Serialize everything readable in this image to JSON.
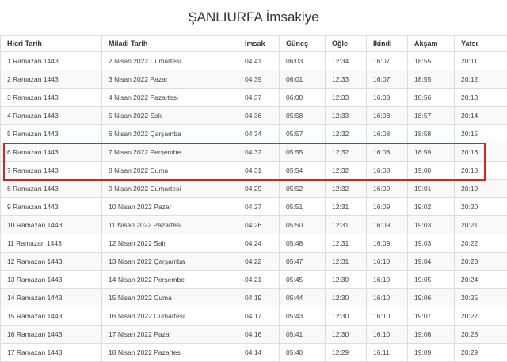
{
  "title": "ŞANLIURFA İmsakiye",
  "columns": [
    "Hicri Tarih",
    "Miladi Tarih",
    "İmsak",
    "Güneş",
    "Öğle",
    "İkindi",
    "Akşam",
    "Yatsı"
  ],
  "rows": [
    [
      "1 Ramazan 1443",
      "2 Nisan 2022 Cumartesi",
      "04:41",
      "06:03",
      "12:34",
      "16:07",
      "18:55",
      "20:11"
    ],
    [
      "2 Ramazan 1443",
      "3 Nisan 2022 Pazar",
      "04:39",
      "06:01",
      "12:33",
      "16:07",
      "18:55",
      "20:12"
    ],
    [
      "3 Ramazan 1443",
      "4 Nisan 2022 Pazartesi",
      "04:37",
      "06:00",
      "12:33",
      "16:08",
      "18:56",
      "20:13"
    ],
    [
      "4 Ramazan 1443",
      "5 Nisan 2022 Salı",
      "04:36",
      "05:58",
      "12:33",
      "16:08",
      "18:57",
      "20:14"
    ],
    [
      "5 Ramazan 1443",
      "6 Nisan 2022 Çarşamba",
      "04:34",
      "05:57",
      "12:32",
      "16:08",
      "18:58",
      "20:15"
    ],
    [
      "6 Ramazan 1443",
      "7 Nisan 2022 Perşembe",
      "04:32",
      "05:55",
      "12:32",
      "16:08",
      "18:59",
      "20:16"
    ],
    [
      "7 Ramazan 1443",
      "8 Nisan 2022 Cuma",
      "04:31",
      "05:54",
      "12:32",
      "16:08",
      "19:00",
      "20:18"
    ],
    [
      "8 Ramazan 1443",
      "9 Nisan 2022 Cumartesi",
      "04:29",
      "05:52",
      "12:32",
      "16:09",
      "19:01",
      "20:19"
    ],
    [
      "9 Ramazan 1443",
      "10 Nisan 2022 Pazar",
      "04:27",
      "05:51",
      "12:31",
      "16:09",
      "19:02",
      "20:20"
    ],
    [
      "10 Ramazan 1443",
      "11 Nisan 2022 Pazartesi",
      "04:26",
      "05:50",
      "12:31",
      "16:09",
      "19:03",
      "20:21"
    ],
    [
      "11 Ramazan 1443",
      "12 Nisan 2022 Salı",
      "04:24",
      "05:48",
      "12:31",
      "16:09",
      "19:03",
      "20:22"
    ],
    [
      "12 Ramazan 1443",
      "13 Nisan 2022 Çarşamba",
      "04:22",
      "05:47",
      "12:31",
      "16:10",
      "19:04",
      "20:23"
    ],
    [
      "13 Ramazan 1443",
      "14 Nisan 2022 Perşembe",
      "04:21",
      "05:45",
      "12:30",
      "16:10",
      "19:05",
      "20:24"
    ],
    [
      "14 Ramazan 1443",
      "15 Nisan 2022 Cuma",
      "04:19",
      "05:44",
      "12:30",
      "16:10",
      "19:06",
      "20:25"
    ],
    [
      "15 Ramazan 1443",
      "16 Nisan 2022 Cumartesi",
      "04:17",
      "05:43",
      "12:30",
      "16:10",
      "19:07",
      "20:27"
    ],
    [
      "16 Ramazan 1443",
      "17 Nisan 2022 Pazar",
      "04:16",
      "05:41",
      "12:30",
      "16:10",
      "19:08",
      "20:28"
    ],
    [
      "17 Ramazan 1443",
      "18 Nisan 2022 Pazartesi",
      "04:14",
      "05:40",
      "12:29",
      "16:11",
      "19:09",
      "20:29"
    ]
  ],
  "highlight_color": "#e01f1f",
  "highlighted_rows": [
    5,
    6
  ]
}
